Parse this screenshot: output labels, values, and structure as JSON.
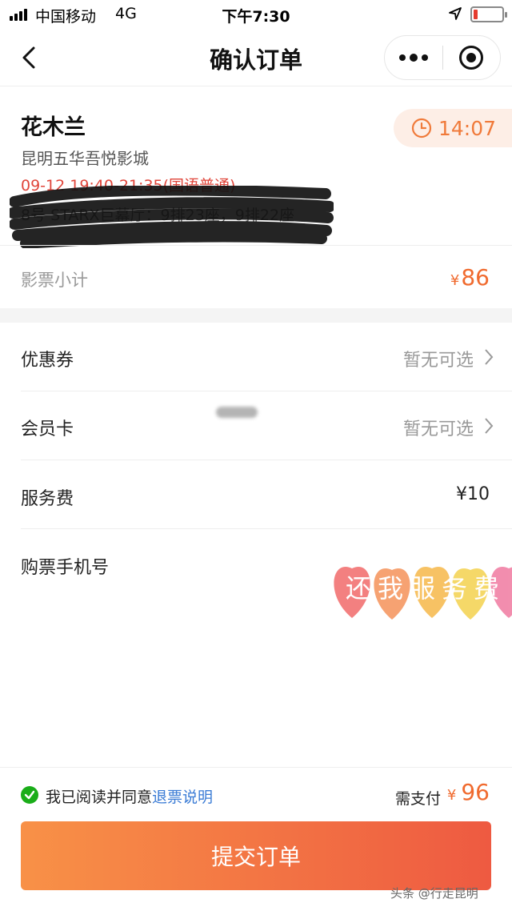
{
  "status_bar": {
    "carrier": "中国移动",
    "network": "4G",
    "time": "下午7:30"
  },
  "nav": {
    "title": "确认订单"
  },
  "order": {
    "movie_title": "花木兰",
    "countdown": "14:07",
    "cinema": "昆明五华吾悦影城",
    "showtime": "09-12 19:40-21:35(国语普通)",
    "seat_info": "8号 STARX巨幕厅：9排23座，9排22座",
    "subtotal_label": "影票小计",
    "subtotal_currency": "¥",
    "subtotal_value": "86"
  },
  "options": {
    "coupon_label": "优惠券",
    "coupon_value": "暂无可选",
    "member_label": "会员卡",
    "member_value": "暂无可选",
    "service_label": "服务费",
    "service_value": "¥10",
    "phone_label": "购票手机号"
  },
  "sticker": {
    "text": "还我服务费",
    "colors": [
      "#f26a6a",
      "#f5925a",
      "#f6b84a",
      "#f4d24e",
      "#f07aa0"
    ]
  },
  "footer": {
    "agree_text": "我已阅读并同意",
    "agree_link": "退票说明",
    "pay_label": "需支付",
    "pay_currency": "¥",
    "pay_value": "96",
    "submit_label": "提交订单",
    "watermark": "头条 @行走昆明"
  },
  "colors": {
    "accent": "#f06a2e",
    "showtime": "#e0453a",
    "link": "#3a7bd5",
    "check": "#1aad19"
  }
}
